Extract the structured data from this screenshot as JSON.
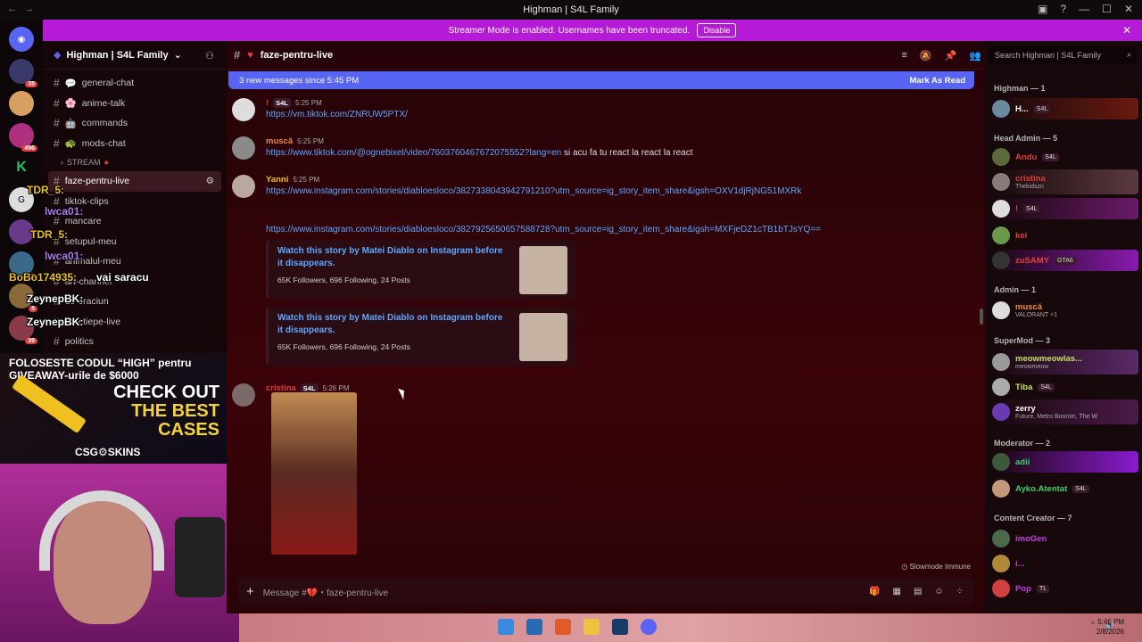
{
  "window": {
    "title": "Highman | S4L Family",
    "controls": [
      "▢",
      "?",
      "—",
      "☐",
      "✕"
    ]
  },
  "banner": {
    "text": "Streamer Mode is enabled. Usernames have been truncated.",
    "button": "Disable"
  },
  "server": {
    "name": "Highman | S4L Family"
  },
  "guild_badges": [
    "35",
    "496",
    "1",
    "5",
    "39"
  ],
  "channels": [
    {
      "name": "general-chat",
      "emoji": "💬"
    },
    {
      "name": "anime-talk",
      "emoji": "🌸"
    },
    {
      "name": "commands",
      "emoji": "🤖"
    },
    {
      "name": "mods-chat",
      "emoji": "🐢"
    }
  ],
  "category": "STREAM",
  "stream_channels": [
    {
      "name": "faze-pentru-live",
      "active": true
    },
    {
      "name": "tiktok-clips"
    },
    {
      "name": "mancare"
    },
    {
      "name": "setupul-meu"
    },
    {
      "name": "animalul-meu"
    },
    {
      "name": "art-channel"
    },
    {
      "name": "de-craciun"
    },
    {
      "name": "reactiepe-live"
    },
    {
      "name": "politics"
    }
  ],
  "overlay_chat": [
    {
      "user": "TDR_5:",
      "text": ""
    },
    {
      "user": "lwca01:",
      "text": ""
    },
    {
      "user": "TDR_5:",
      "text": ""
    },
    {
      "user": "lwca01:",
      "text": ""
    },
    {
      "user": "BoBo174935:",
      "text": "vai saracu"
    },
    {
      "user": "ZeynepBK:",
      "text": ""
    },
    {
      "user": "ZeynepBK:",
      "text": ""
    }
  ],
  "promo": {
    "line1": "FOLOSESTE CODUL “HIGH” pentru",
    "line2": "GIVEAWAY-urile de $6000",
    "big1": "CHECK OUT",
    "big2": "THE BEST",
    "big3": "CASES",
    "brand": "CSG⚙SKINS"
  },
  "channel": {
    "name": "faze-pentru-live"
  },
  "new_messages": {
    "text": "3 new messages since 5:45 PM",
    "action": "Mark As Read"
  },
  "messages": [
    {
      "name": "!",
      "tag": "S4L",
      "time": "5:25 PM",
      "color": "#e23c3c",
      "body": "https://vm.tiktok.com/ZNRUW5PTX/",
      "extra": ""
    },
    {
      "name": "muscă",
      "tag": "",
      "time": "5:25 PM",
      "color": "#f08a3c",
      "body": "https://www.tiktok.com/@ognebixel/video/7603760467672075552?lang=en",
      "extra": " si acu fa tu react la react la react"
    },
    {
      "name": "Yanni",
      "tag": "",
      "time": "5:25 PM",
      "color": "#f0c020",
      "body": "https://www.instagram.com/stories/diabloesloco/3827338043942791210?utm_source=ig_story_item_share&igsh=OXV1djRjNG51MXRk",
      "extra": ""
    },
    {
      "name": "",
      "tag": "",
      "time": "",
      "color": "#fff",
      "body": "https://www.instagram.com/stories/diabloesloco/3827925650657588728?utm_source=ig_story_item_share&igsh=MXFjeDZ1cTB1bTJsYQ==",
      "extra": ""
    },
    {
      "name": "cristina",
      "tag": "S4L",
      "time": "5:26 PM",
      "color": "#e23c3c",
      "body": "",
      "extra": ""
    }
  ],
  "embeds": [
    {
      "title": "Watch this story by Matei Diablo on Instagram before it disappears.",
      "desc": "65K Followers, 696 Following, 24 Posts"
    },
    {
      "title": "Watch this story by Matei Diablo on Instagram before it disappears.",
      "desc": "65K Followers, 696 Following, 24 Posts"
    }
  ],
  "composer": {
    "placeholder": "Message #💔・faze-pentru-live",
    "slowmode": "Slowmode Immune"
  },
  "search": {
    "placeholder": "Search Highman | S4L Family"
  },
  "member_groups": [
    {
      "label": "Highman — 1"
    },
    {
      "label": "Head Admin — 5"
    },
    {
      "label": "Admin — 1"
    },
    {
      "label": "SuperMod — 3"
    },
    {
      "label": "Moderator — 2"
    },
    {
      "label": "Content Creator — 7"
    }
  ],
  "members": [
    {
      "name": "H...",
      "sub": "",
      "color": "#fff"
    },
    {
      "name": "Andu",
      "sub": "",
      "color": "#e23c3c"
    },
    {
      "name": "cristina",
      "sub": "Thekidszn",
      "color": "#e23c3c"
    },
    {
      "name": "!",
      "sub": "",
      "color": "#e23c3c"
    },
    {
      "name": "kei",
      "sub": "",
      "color": "#e23c3c"
    },
    {
      "name": "zuSAMY",
      "sub": "",
      "color": "#e23c3c"
    },
    {
      "name": "muscă",
      "sub": "VALORANT +1",
      "color": "#f08a3c"
    },
    {
      "name": "meowmeowlas...",
      "sub": "meowmeow",
      "color": "#c8e06a"
    },
    {
      "name": "Tiba",
      "sub": "",
      "color": "#c8e06a"
    },
    {
      "name": "zerry",
      "sub": "Future, Metro Boomin, The W",
      "color": "#fff"
    },
    {
      "name": "adii",
      "sub": "",
      "color": "#3cd06a"
    },
    {
      "name": "Ayko.Atentat",
      "sub": "",
      "color": "#3cd06a"
    },
    {
      "name": "imoGen",
      "sub": "",
      "color": "#c040e0"
    },
    {
      "name": "i...",
      "sub": "",
      "color": "#c040e0"
    },
    {
      "name": "Pop",
      "sub": "",
      "color": "#c040e0"
    }
  ],
  "member_tags": {
    "s4l": "S4L",
    "gta": "GTA6",
    "tl": "TL"
  },
  "taskbar": {
    "time": "5:46 PM",
    "date": "2/8/2026"
  }
}
